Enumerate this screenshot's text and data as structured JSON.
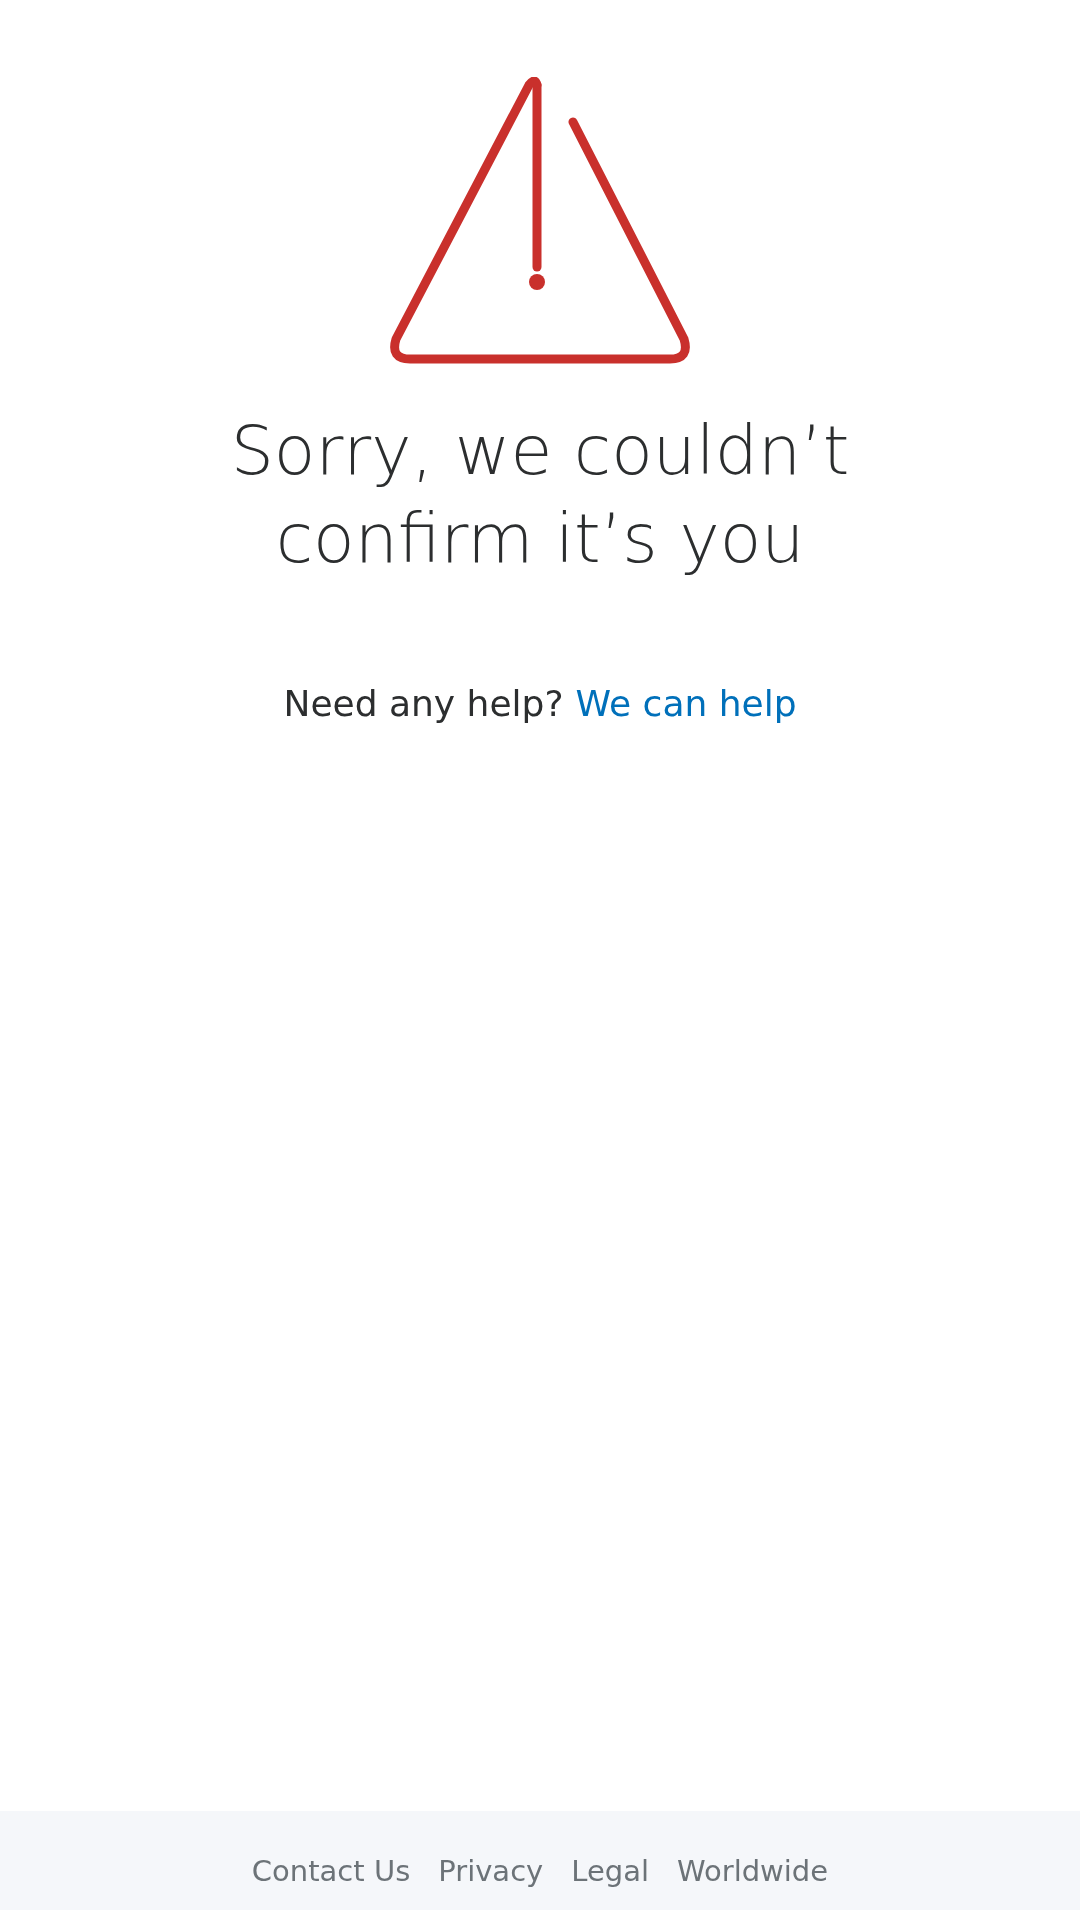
{
  "message": {
    "title": "Sorry, we couldn’t confirm it’s you",
    "help_prompt": "Need any help?",
    "help_link": "We can help"
  },
  "footer": {
    "links": [
      "Contact Us",
      "Privacy",
      "Legal",
      "Worldwide"
    ]
  }
}
